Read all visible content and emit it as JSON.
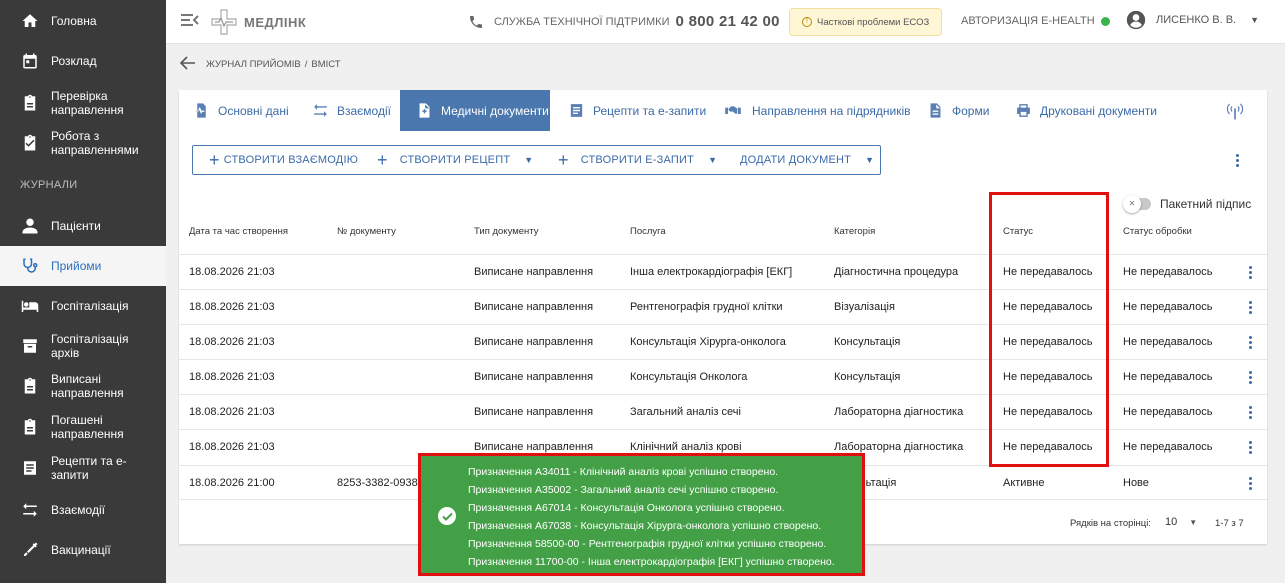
{
  "sidebar": {
    "items": [
      {
        "label": "Головна",
        "icon": "home-icon"
      },
      {
        "label": "Розклад",
        "icon": "calendar-icon"
      },
      {
        "label": "Перевірка направлення",
        "icon": "clipboard-icon"
      },
      {
        "label": "Робота з направленнями",
        "icon": "clipboard-check-icon"
      }
    ],
    "section_label": "ЖУРНАЛИ",
    "journal_items": [
      {
        "label": "Пацієнти",
        "icon": "person-icon"
      },
      {
        "label": "Прийоми",
        "icon": "stethoscope-icon"
      },
      {
        "label": "Госпіталізація",
        "icon": "bed-icon"
      },
      {
        "label": "Госпіталізація архів",
        "icon": "archive-icon"
      },
      {
        "label": "Виписані направлення",
        "icon": "clipboard-icon"
      },
      {
        "label": "Погашені направлення",
        "icon": "clipboard-icon"
      },
      {
        "label": "Рецепти та е-запити",
        "icon": "list-icon"
      },
      {
        "label": "Взаємодії",
        "icon": "swap-icon"
      },
      {
        "label": "Вакцинації",
        "icon": "syringe-icon"
      }
    ]
  },
  "header": {
    "logo_text": "МЕДЛІНК",
    "support_label": "СЛУЖБА ТЕХНІЧНОЇ ПІДТРИМКИ",
    "support_phone": "0 800 21 42 00",
    "warning": "Часткові проблеми ЕСОЗ",
    "auth_label": "АВТОРИЗАЦІЯ E-HEALTH",
    "auth_status_color": "#3bb34a",
    "user_name": "ЛИСЕНКО В. В."
  },
  "breadcrumb": {
    "parent": "ЖУРНАЛ ПРИЙОМІВ",
    "current": "ВМІСТ"
  },
  "tabs": [
    {
      "label": "Основні дані",
      "icon": "vitals-icon"
    },
    {
      "label": "Взаємодії",
      "icon": "swap-icon"
    },
    {
      "label": "Медичні документи",
      "icon": "doc-plus-icon"
    },
    {
      "label": "Рецепти та е-запити",
      "icon": "list-icon"
    },
    {
      "label": "Направлення на підрядників",
      "icon": "handshake-icon"
    },
    {
      "label": "Форми",
      "icon": "doc-icon"
    },
    {
      "label": "Друковані документи",
      "icon": "print-icon"
    }
  ],
  "actions": {
    "create_interaction": "СТВОРИТИ ВЗАЄМОДІЮ",
    "create_recipe": "СТВОРИТИ РЕЦЕПТ",
    "create_erequest": "СТВОРИТИ Е-ЗАПИТ",
    "add_document": "ДОДАТИ ДОКУМЕНТ"
  },
  "batch_sign_label": "Пакетний підпис",
  "table": {
    "columns": [
      "Дата та час створення",
      "№ документу",
      "Тип документу",
      "Послуга",
      "Категорія",
      "Статус",
      "Статус обробки"
    ],
    "rows": [
      [
        "18.08.2026 21:03",
        "",
        "Виписане направлення",
        "Інша електрокардіографія [ЕКГ]",
        "Діагностична процедура",
        "Не передавалось",
        "Не передавалось"
      ],
      [
        "18.08.2026 21:03",
        "",
        "Виписане направлення",
        "Рентгенографія грудної клітки",
        "Візуалізація",
        "Не передавалось",
        "Не передавалось"
      ],
      [
        "18.08.2026 21:03",
        "",
        "Виписане направлення",
        "Консультація Хірурга-онколога",
        "Консультація",
        "Не передавалось",
        "Не передавалось"
      ],
      [
        "18.08.2026 21:03",
        "",
        "Виписане направлення",
        "Консультація Онколога",
        "Консультація",
        "Не передавалось",
        "Не передавалось"
      ],
      [
        "18.08.2026 21:03",
        "",
        "Виписане направлення",
        "Загальний аналіз сечі",
        "Лабораторна діагностика",
        "Не передавалось",
        "Не передавалось"
      ],
      [
        "18.08.2026 21:03",
        "",
        "Виписане направлення",
        "Клінічний аналіз крові",
        "Лабораторна діагностика",
        "Не передавалось",
        "Не передавалось"
      ],
      [
        "18.08.2026 21:00",
        "8253-3382-0938-",
        "",
        "",
        "ультація",
        "Активне",
        "Нове"
      ]
    ]
  },
  "pager": {
    "rows_per_page_label": "Рядків на сторінці:",
    "rows_per_page": "10",
    "range": "1-7 з 7"
  },
  "toast": {
    "lines": [
      "Призначення А34011 - Клінічний аналіз крові успішно створено.",
      "Призначення А35002 - Загальний аналіз сечі успішно створено.",
      "Призначення А67014 - Консультація Онколога успішно створено.",
      "Призначення А67038 - Консультація Хірурга-онколога успішно створено.",
      "Призначення 58500-00 - Рентгенографія грудної клітки успішно створено.",
      "Призначення 11700-00 - Інша електрокардіографія [ЕКГ] успішно створено."
    ]
  },
  "colors": {
    "sidebar_bg": "#3a3a3a",
    "accent": "#4a77ad",
    "toast_bg": "#43a047",
    "highlight": "#e01010"
  }
}
